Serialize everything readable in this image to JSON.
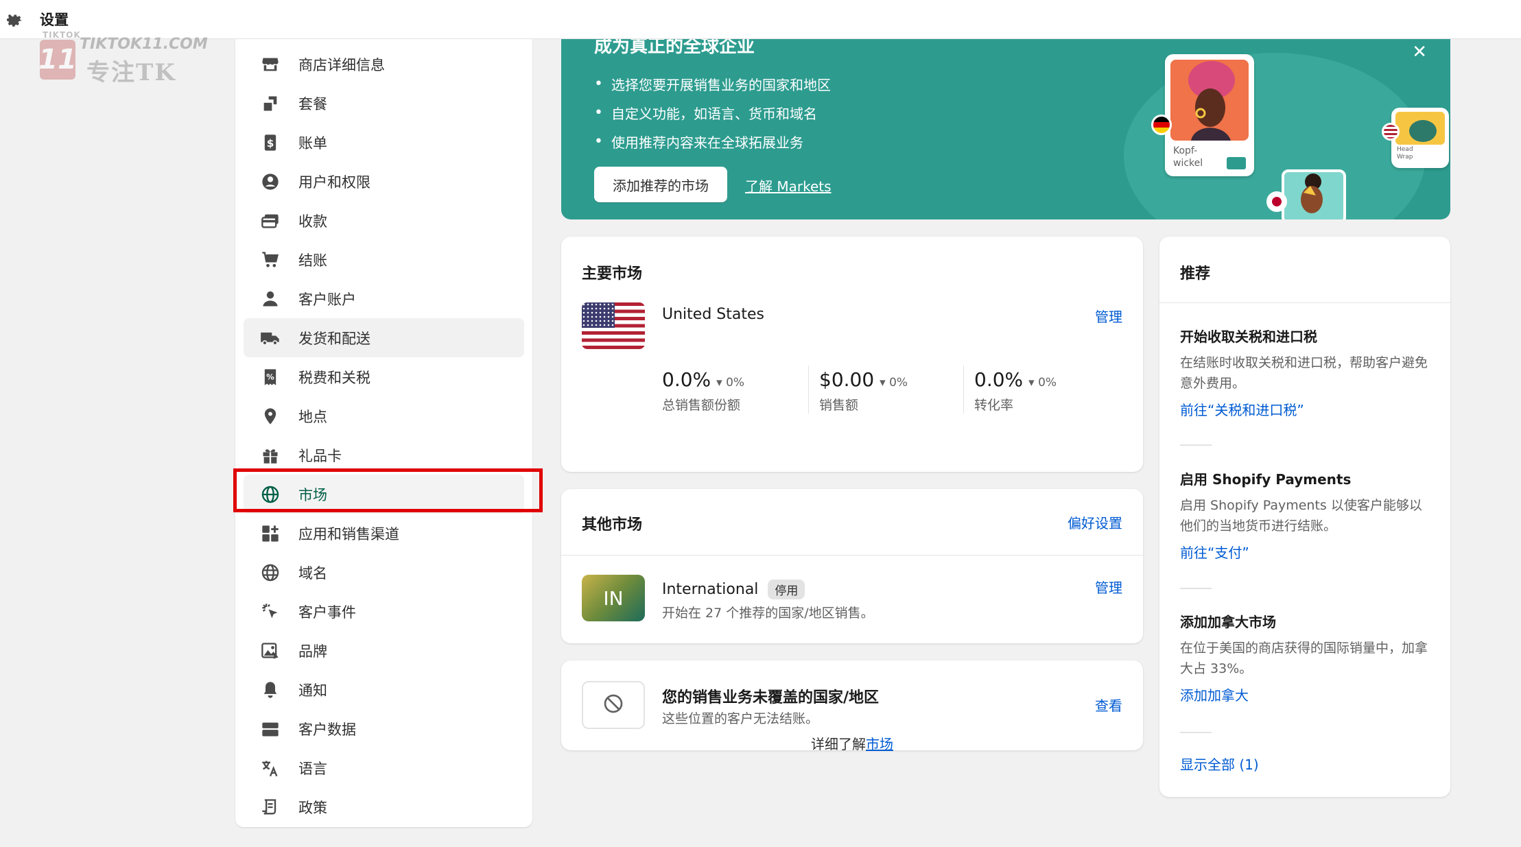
{
  "topbar": {
    "title": "设置"
  },
  "watermark": {
    "small": "TIKTOK",
    "number": "11",
    "site": "TIKTOK11.COM",
    "cn": "专注TK"
  },
  "sidebar": {
    "items": [
      {
        "label": "商店详细信息",
        "icon": "store-icon"
      },
      {
        "label": "套餐",
        "icon": "plan-icon"
      },
      {
        "label": "账单",
        "icon": "billing-icon"
      },
      {
        "label": "用户和权限",
        "icon": "user-circle-icon"
      },
      {
        "label": "收款",
        "icon": "payment-card-icon"
      },
      {
        "label": "结账",
        "icon": "cart-icon"
      },
      {
        "label": "客户账户",
        "icon": "person-icon"
      },
      {
        "label": "发货和配送",
        "icon": "truck-icon"
      },
      {
        "label": "税费和关税",
        "icon": "tax-icon"
      },
      {
        "label": "地点",
        "icon": "location-pin-icon"
      },
      {
        "label": "礼品卡",
        "icon": "gift-icon"
      },
      {
        "label": "市场",
        "icon": "globe-icon"
      },
      {
        "label": "应用和销售渠道",
        "icon": "apps-icon"
      },
      {
        "label": "域名",
        "icon": "domain-globe-icon"
      },
      {
        "label": "客户事件",
        "icon": "cursor-click-icon"
      },
      {
        "label": "品牌",
        "icon": "brand-image-icon"
      },
      {
        "label": "通知",
        "icon": "bell-icon"
      },
      {
        "label": "客户数据",
        "icon": "data-folder-icon"
      },
      {
        "label": "语言",
        "icon": "translate-icon"
      },
      {
        "label": "政策",
        "icon": "policy-document-icon"
      }
    ]
  },
  "banner": {
    "title": "成为真正的全球企业",
    "bullets": [
      "选择您要开展销售业务的国家和地区",
      "自定义功能，如语言、货币和域名",
      "使用推荐内容来在全球拓展业务"
    ],
    "add_button": "添加推荐的市场",
    "learn_link": "了解 Markets",
    "card1_text": "Kopf-\nwickel",
    "card2_text": "Head\nWrap"
  },
  "primary": {
    "title": "主要市场",
    "country": "United States",
    "manage": "管理",
    "stats": [
      {
        "value": "0.0%",
        "delta": "0%",
        "label": "总销售额份额"
      },
      {
        "value": "$0.00",
        "delta": "0%",
        "label": "销售额"
      },
      {
        "value": "0.0%",
        "delta": "0%",
        "label": "转化率"
      }
    ]
  },
  "other": {
    "title": "其他市场",
    "preferences": "偏好设置",
    "tile": "IN",
    "name": "International",
    "badge": "停用",
    "desc": "开始在 27 个推荐的国家/地区销售。",
    "manage": "管理"
  },
  "uncovered": {
    "title": "您的销售业务未覆盖的国家/地区",
    "desc": "这些位置的客户无法结账。",
    "view": "查看"
  },
  "learn_more": {
    "prefix": "详细了解",
    "link": "市场"
  },
  "recommend": {
    "title": "推荐",
    "items": [
      {
        "title": "开始收取关税和进口税",
        "desc": "在结账时收取关税和进口税，帮助客户避免意外费用。",
        "link": "前往“关税和进口税”"
      },
      {
        "title": "启用 Shopify Payments",
        "desc": "启用 Shopify Payments 以使客户能够以他们的当地货币进行结账。",
        "link": "前往“支付”"
      },
      {
        "title": "添加加拿大市场",
        "desc": "在位于美国的商店获得的国际销量中，加拿大占 33%。",
        "link": "添加加拿大"
      }
    ],
    "show_all": "显示全部 (1)"
  },
  "colors": {
    "accent": "#005bd3",
    "banner": "#2d9c8f",
    "highlight": "#e00000",
    "active_nav": "#005e46"
  }
}
